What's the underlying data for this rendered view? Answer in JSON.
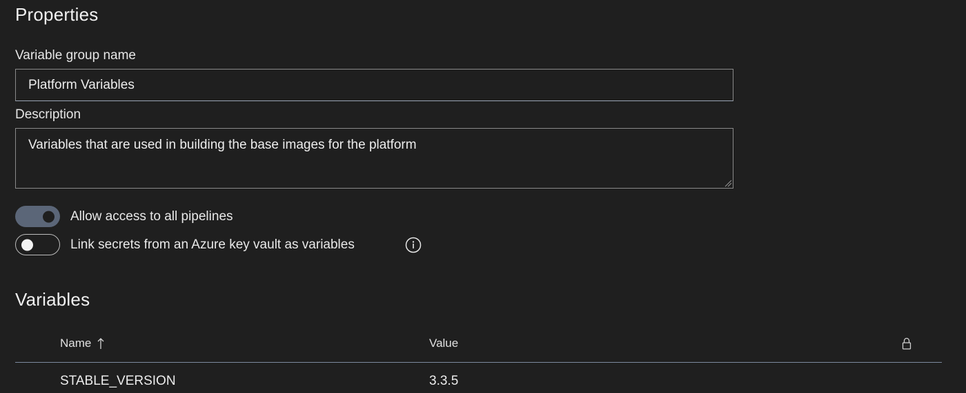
{
  "properties": {
    "title": "Properties",
    "group_name_label": "Variable group name",
    "group_name_value": "Platform Variables",
    "description_label": "Description",
    "description_value": "Variables that are used in building the base images for the platform",
    "allow_access_label": "Allow access to all pipelines",
    "allow_access_enabled": true,
    "link_secrets_label": "Link secrets from an Azure key vault as variables",
    "link_secrets_enabled": false
  },
  "variables": {
    "title": "Variables",
    "columns": {
      "name": "Name",
      "value": "Value",
      "secret_icon": "lock-icon"
    },
    "rows": [
      {
        "name": "STABLE_VERSION",
        "value": "3.3.5"
      }
    ]
  },
  "colors": {
    "background": "#1f1f1f",
    "toggle_on": "#5b6678",
    "divider": "#7d8aa0"
  }
}
